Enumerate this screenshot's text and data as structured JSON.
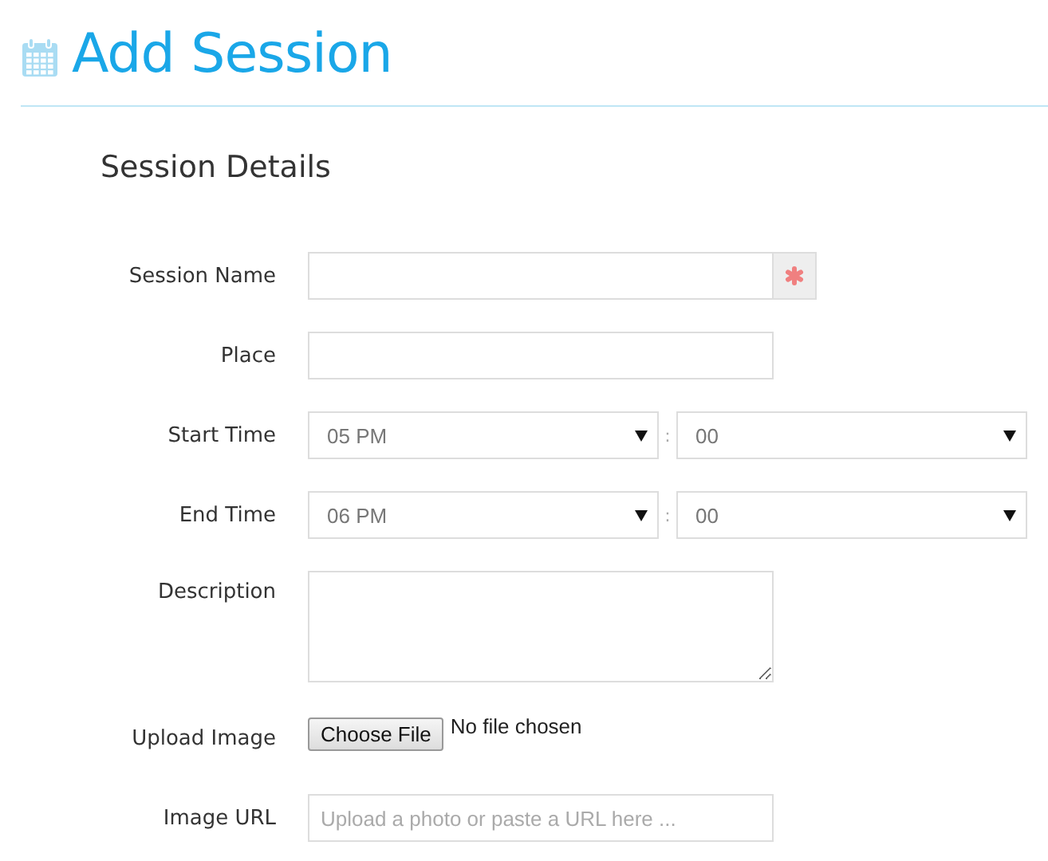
{
  "page": {
    "title": "Add Session"
  },
  "section": {
    "title": "Session Details"
  },
  "fields": [
    {
      "kind": "text",
      "label": "Session Name",
      "required": true
    },
    {
      "kind": "text",
      "label": "Place",
      "required": false
    },
    {
      "kind": "time",
      "label": "Start Time",
      "hour": "05 PM",
      "separator": ":",
      "minute": "00"
    },
    {
      "kind": "time",
      "label": "End Time",
      "hour": "06 PM",
      "separator": ":",
      "minute": "00"
    },
    {
      "kind": "textarea",
      "label": "Description"
    },
    {
      "kind": "file",
      "label": "Upload Image",
      "button": "Choose File",
      "status": "No file chosen"
    },
    {
      "kind": "text",
      "label": "Image URL",
      "placeholder": "Upload a photo or paste a URL here ...",
      "required": false
    }
  ]
}
